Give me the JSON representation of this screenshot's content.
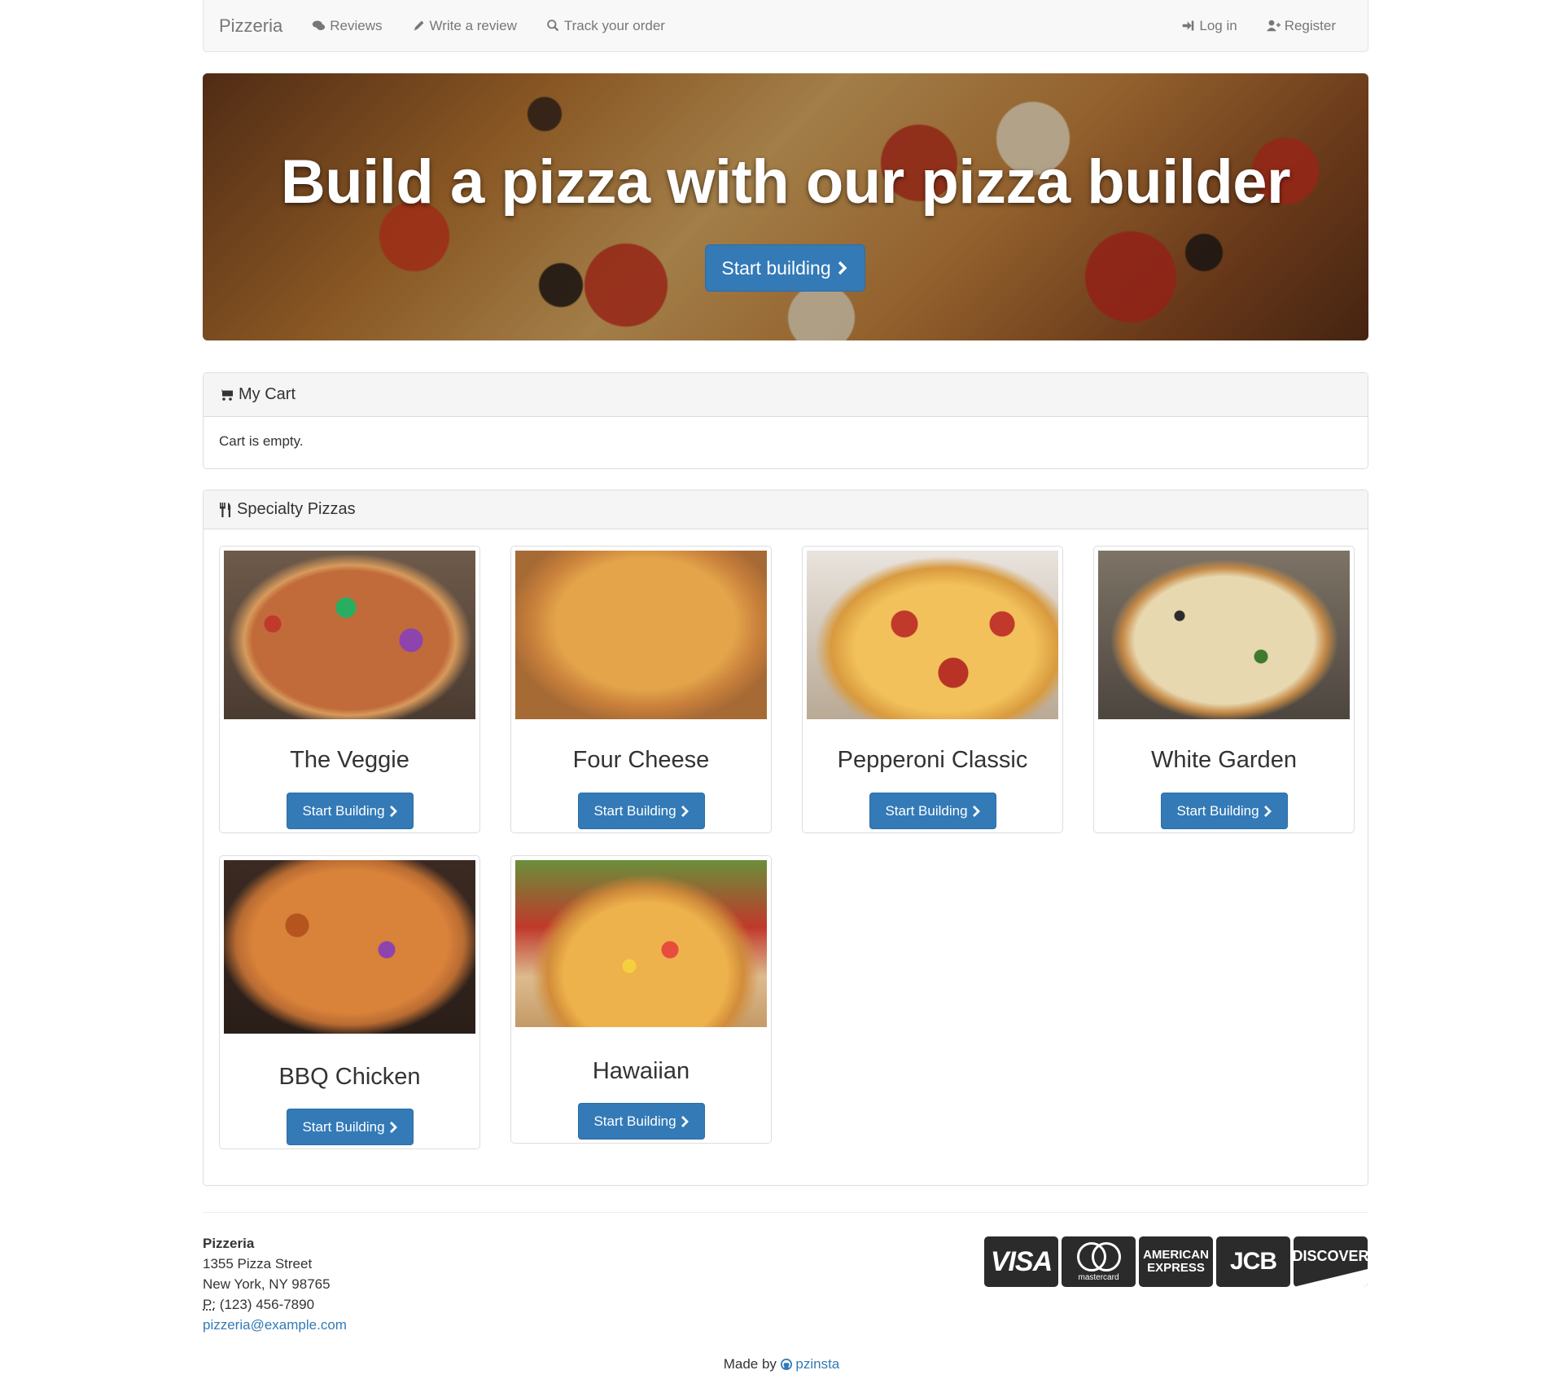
{
  "navbar": {
    "brand": "Pizzeria",
    "links": [
      {
        "label": "Reviews",
        "icon": "comments-icon"
      },
      {
        "label": "Write a review",
        "icon": "pencil-icon"
      },
      {
        "label": "Track your order",
        "icon": "search-icon"
      }
    ],
    "right": [
      {
        "label": "Log in",
        "icon": "sign-in-icon"
      },
      {
        "label": "Register",
        "icon": "user-plus-icon"
      }
    ]
  },
  "hero": {
    "title": "Build a pizza with our pizza builder",
    "button": "Start building"
  },
  "cart": {
    "title": "My Cart",
    "empty_text": "Cart is empty."
  },
  "specialty": {
    "title": "Specialty Pizzas",
    "button_label": "Start Building",
    "pizzas": [
      {
        "name": "The Veggie"
      },
      {
        "name": "Four Cheese"
      },
      {
        "name": "Pepperoni Classic"
      },
      {
        "name": "White Garden"
      },
      {
        "name": "BBQ Chicken"
      },
      {
        "name": "Hawaiian"
      }
    ]
  },
  "footer": {
    "name": "Pizzeria",
    "street": "1355 Pizza Street",
    "city": "New York, NY 98765",
    "phone_abbr": "P:",
    "phone": "(123) 456-7890",
    "email": "pizzeria@example.com",
    "cards": {
      "visa": "VISA",
      "mastercard": "mastercard",
      "amex_line1": "AMERICAN",
      "amex_line2": "EXPRESS",
      "jcb": "JCB",
      "discover": "DISCOVER"
    },
    "made_by_prefix": "Made by",
    "made_by_author": "pzinsta"
  },
  "colors": {
    "primary": "#337ab7",
    "navbar_bg": "#f8f8f8",
    "panel_head_bg": "#f5f5f5",
    "link": "#337ab7"
  }
}
